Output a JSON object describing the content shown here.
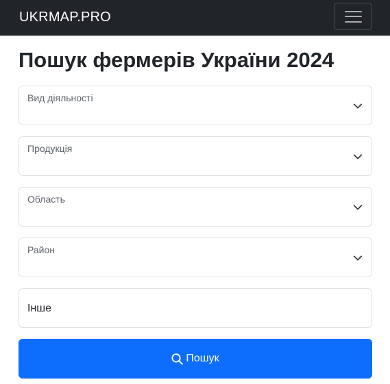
{
  "navbar": {
    "brand": "UKRMAP.PRO",
    "toggler_icon": "hamburger-menu-icon"
  },
  "page": {
    "title": "Пошук фермерів України 2024"
  },
  "form": {
    "selects": [
      {
        "label": "Вид діяльності",
        "selected": ""
      },
      {
        "label": "Продукція",
        "selected": ""
      },
      {
        "label": "Область",
        "selected": ""
      },
      {
        "label": "Район",
        "selected": ""
      }
    ],
    "other": {
      "value": "",
      "placeholder": "Інше"
    },
    "submit": {
      "label": "Пошук",
      "icon": "search-icon"
    }
  },
  "colors": {
    "navbar_bg": "#212529",
    "primary": "#0d6efd",
    "border": "#dee2e6",
    "label_muted": "#5c636a"
  }
}
